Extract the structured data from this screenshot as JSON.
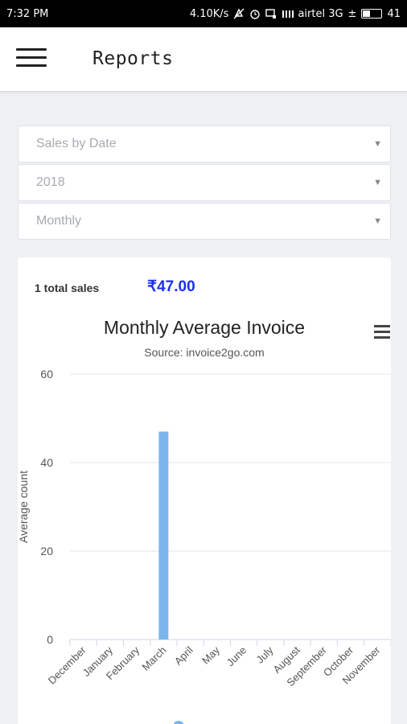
{
  "status_bar": {
    "time": "7:32 PM",
    "speed": "4.10K/s",
    "carrier": "airtel 3G",
    "battery": "41",
    "battery_level": 0.41
  },
  "app_bar": {
    "title": "Reports",
    "menu_icon": "hamburger-menu-icon"
  },
  "filters": {
    "report_type": "Sales by Date",
    "year": "2018",
    "period": "Monthly"
  },
  "summary": {
    "total_sales_label": "1 total sales",
    "total_amount": "₹47.00"
  },
  "chart_menu_icon": "hamburger-menu-icon",
  "chart_data": {
    "type": "bar",
    "title": "Monthly Average Invoice",
    "subtitle": "Source: invoice2go.com",
    "xlabel": "",
    "ylabel": "Average count",
    "categories": [
      "December",
      "January",
      "February",
      "March",
      "April",
      "May",
      "June",
      "July",
      "August",
      "September",
      "October",
      "November"
    ],
    "values": [
      0,
      0,
      0,
      47,
      0,
      0,
      0,
      0,
      0,
      0,
      0,
      0
    ],
    "ylim": [
      0,
      60
    ],
    "yticks": [
      0,
      20,
      40,
      60
    ],
    "grid": true,
    "color": "#7cb5ec"
  }
}
